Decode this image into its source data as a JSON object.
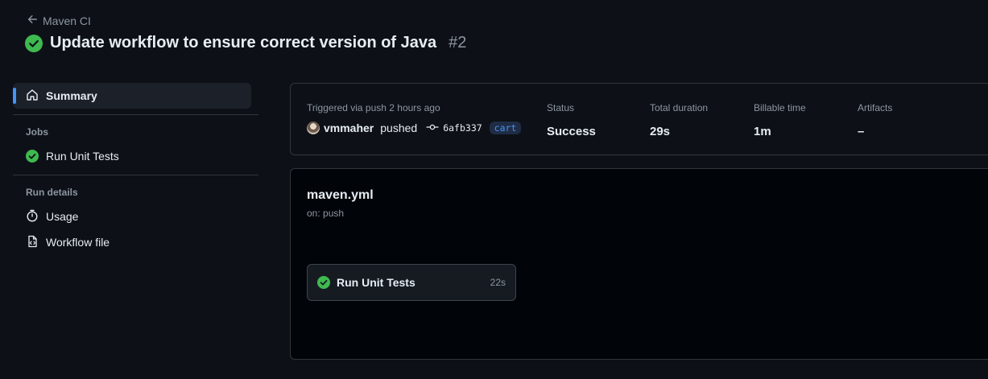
{
  "header": {
    "back_label": "Maven CI",
    "title": "Update workflow to ensure correct version of Java",
    "run_number": "#2"
  },
  "sidebar": {
    "summary_label": "Summary",
    "jobs_heading": "Jobs",
    "jobs": [
      {
        "label": "Run Unit Tests",
        "status": "success"
      }
    ],
    "run_details_heading": "Run details",
    "usage_label": "Usage",
    "workflow_file_label": "Workflow file"
  },
  "summary": {
    "trigger_text": "Triggered via push 2 hours ago",
    "actor": "vmmaher",
    "action": "pushed",
    "commit": "6afb337",
    "branch": "cart",
    "status_label": "Status",
    "status_value": "Success",
    "duration_label": "Total duration",
    "duration_value": "29s",
    "billable_label": "Billable time",
    "billable_value": "1m",
    "artifacts_label": "Artifacts",
    "artifacts_value": "–"
  },
  "workflow": {
    "file": "maven.yml",
    "trigger": "on: push",
    "job_name": "Run Unit Tests",
    "job_duration": "22s"
  },
  "colors": {
    "success": "#3fb950",
    "accent": "#4493f8",
    "background": "#0d1117"
  }
}
